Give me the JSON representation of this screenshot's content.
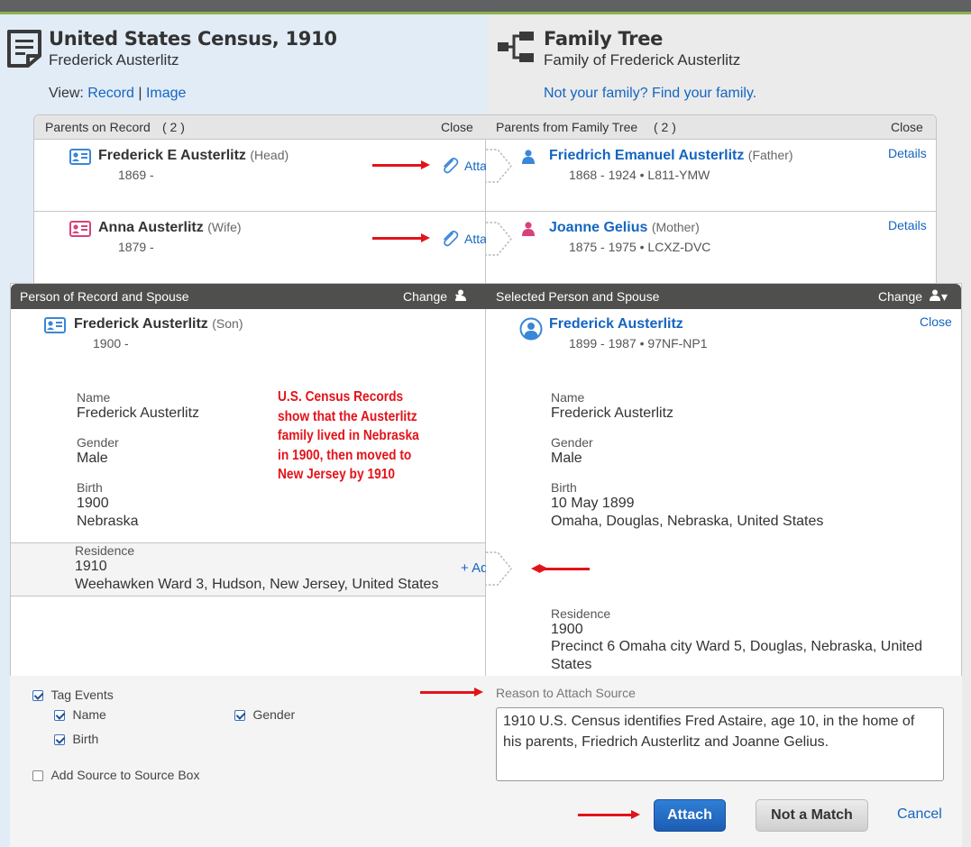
{
  "record": {
    "title": "United States Census, 1910",
    "subtitle": "Frederick Austerlitz",
    "view_label": "View:",
    "view_record": "Record",
    "view_sep": "|",
    "view_image": "Image"
  },
  "tree": {
    "title": "Family Tree",
    "subtitle": "Family of Frederick Austerlitz",
    "find_link": "Not your family? Find your family."
  },
  "parents": {
    "left_header": "Parents on Record",
    "left_count": "( 2 )",
    "left_close": "Close",
    "right_header": "Parents from Family Tree",
    "right_count": "( 2 )",
    "right_close": "Close",
    "rows": [
      {
        "record_name": "Frederick E Austerlitz",
        "record_role": "(Head)",
        "record_dates": "1869 -",
        "attach_label": "Attach",
        "tree_name": "Friedrich Emanuel Austerlitz",
        "tree_role": "(Father)",
        "tree_dates": "1868 - 1924 • L811-YMW",
        "details_label": "Details"
      },
      {
        "record_name": "Anna Austerlitz",
        "record_role": "(Wife)",
        "record_dates": "1879 -",
        "attach_label": "Attach",
        "tree_name": "Joanne Gelius",
        "tree_role": "(Mother)",
        "tree_dates": "1875 - 1975 • LCXZ-DVC",
        "details_label": "Details"
      }
    ]
  },
  "person": {
    "left_header": "Person of Record and Spouse",
    "left_change": "Change",
    "right_header": "Selected Person and Spouse",
    "right_change": "Change",
    "record_name": "Frederick Austerlitz",
    "record_role": "(Son)",
    "record_dates": "1900 -",
    "tree_name": "Frederick Austerlitz",
    "tree_dates": "1899 - 1987 • 97NF-NP1",
    "tree_close": "Close",
    "left_facts": {
      "name_label": "Name",
      "name_value": "Frederick Austerlitz",
      "gender_label": "Gender",
      "gender_value": "Male",
      "birth_label": "Birth",
      "birth_date": "1900",
      "birth_place": "Nebraska",
      "residence_label": "Residence",
      "residence_date": "1910",
      "residence_place": "Weehawken Ward 3, Hudson, New Jersey, United States",
      "add_label": "+ Add"
    },
    "right_facts": {
      "name_label": "Name",
      "name_value": "Frederick Austerlitz",
      "gender_label": "Gender",
      "gender_value": "Male",
      "birth_label": "Birth",
      "birth_date": "10 May 1899",
      "birth_place": "Omaha, Douglas, Nebraska, United States",
      "residence_label": "Residence",
      "residence_date": "1900",
      "residence_place": "Precinct 6 Omaha city Ward 5, Douglas, Nebraska, United States"
    },
    "annotation": "U.S. Census Records show that the Austerlitz family lived in Nebraska in 1900, then moved to New Jersey by 1910"
  },
  "bottom": {
    "tag_events": "Tag Events",
    "tag_name": "Name",
    "tag_gender": "Gender",
    "tag_birth": "Birth",
    "add_source_box": "Add Source to Source Box",
    "reason_label": "Reason to Attach Source",
    "reason_text": "1910 U.S. Census identifies Fred Astaire, age 10, in the home of his parents, Friedrich Austerlitz and Joanne Gelius.",
    "attach_button": "Attach",
    "not_match_button": "Not a Match",
    "cancel_link": "Cancel"
  },
  "colors": {
    "accent_blue": "#1565c0",
    "annotation_red": "#e3131a",
    "header_dark": "#4f504d",
    "record_bg": "#e2ecf7",
    "tree_bg": "#ebebeb"
  }
}
